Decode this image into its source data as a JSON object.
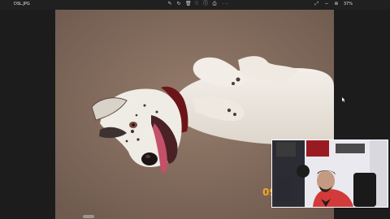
{
  "titlebar": {
    "filename": "DSL.JPG",
    "more": "···",
    "zoom": "37%"
  },
  "photo": {
    "date_stamp": "09"
  },
  "colors": {
    "carpet": "#8a7262",
    "dog_white": "#f0ece6",
    "collar": "#6b1518",
    "tongue": "#c4506a",
    "app_bg": "#1c1c1c"
  }
}
